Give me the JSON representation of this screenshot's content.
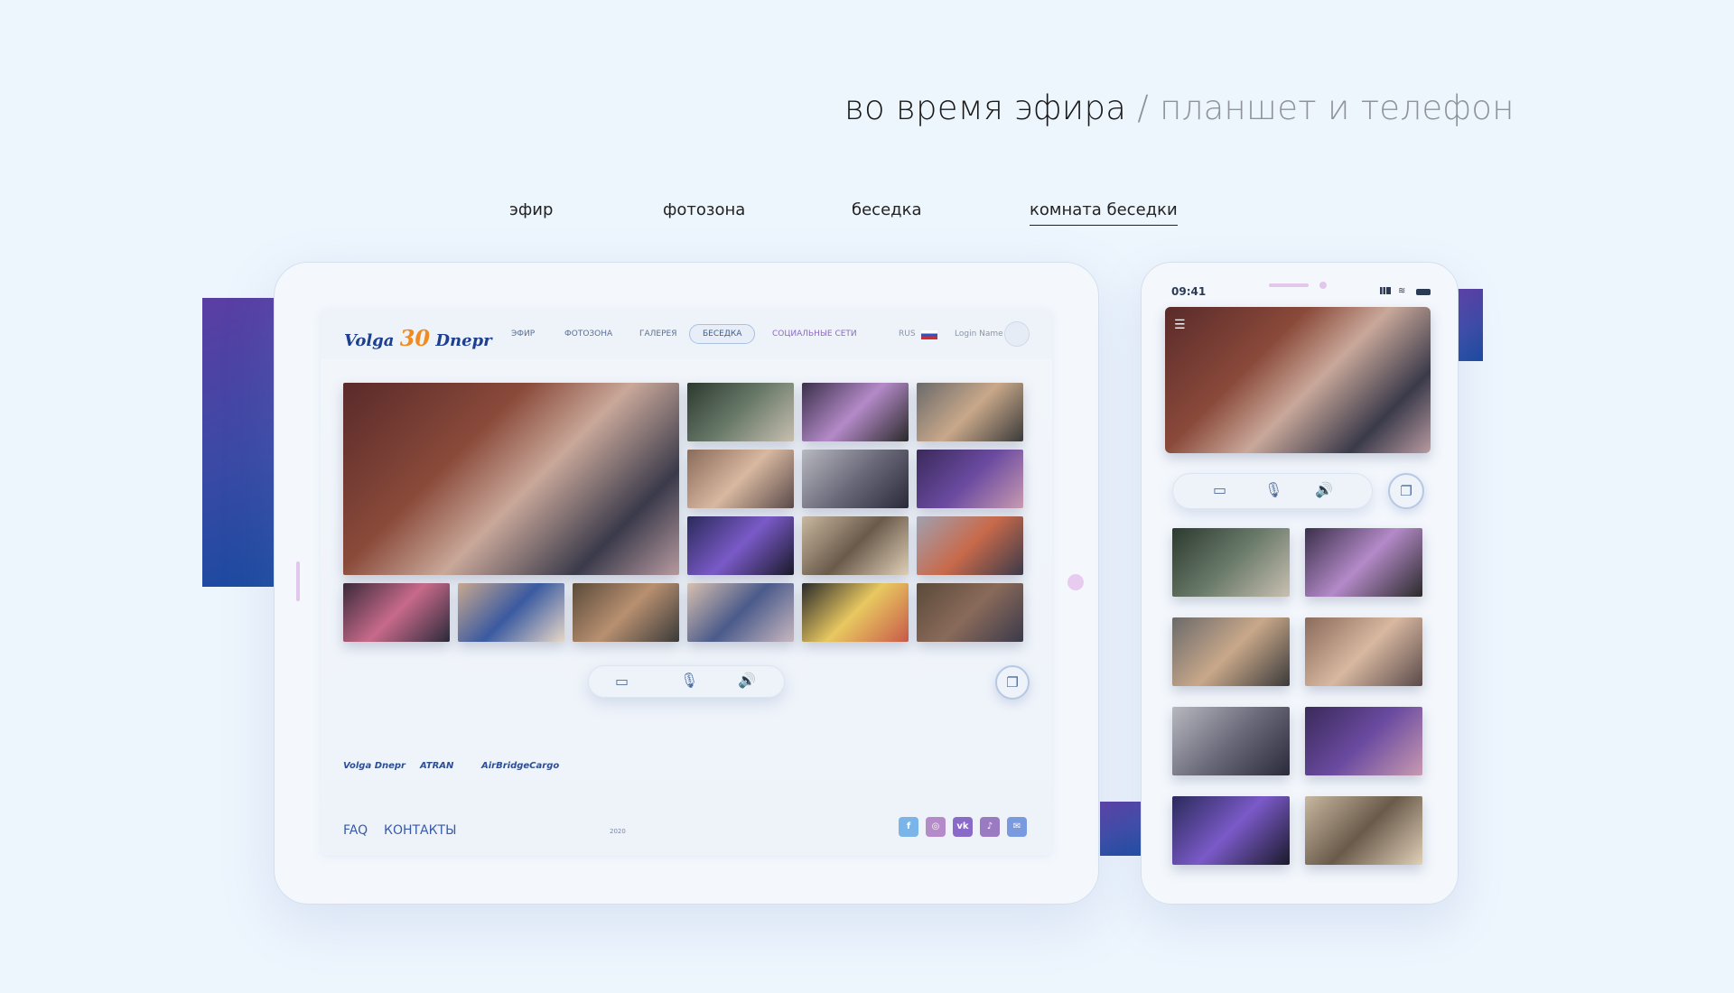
{
  "heading": {
    "main": "во время эфира",
    "separator": " / ",
    "sub": "планшет и телефон"
  },
  "tabs": [
    {
      "label": "эфир",
      "active": false
    },
    {
      "label": "фотозона",
      "active": false
    },
    {
      "label": "беседка",
      "active": false
    },
    {
      "label": "комната беседки",
      "active": true
    }
  ],
  "tablet": {
    "logo": {
      "left": "Volga",
      "num": "30",
      "right": "Dnepr"
    },
    "nav": [
      "ЭФИР",
      "ФОТОЗОНА",
      "ГАЛЕРЕЯ",
      "БЕСЕДКА",
      "СОЦИАЛЬНЫЕ СЕТИ"
    ],
    "lang": "RUS",
    "login": "Login Name",
    "partners": [
      "Volga Dnepr",
      "ATRAN",
      "AirBridgeCargo"
    ],
    "footer": {
      "faq": "FAQ",
      "contacts": "КОНТАКТЫ",
      "year": "2020"
    },
    "social": [
      "f",
      "◎",
      "vk",
      "♪",
      "✉"
    ]
  },
  "phone": {
    "time": "09:41"
  },
  "colors": {
    "accent": "#4a3fa5",
    "link": "#3a5aa6",
    "background": "#edf5fd"
  },
  "icons": {
    "camera": "camera-icon",
    "mic": "microphone-icon",
    "speaker": "speaker-icon",
    "chat": "chat-icon"
  }
}
